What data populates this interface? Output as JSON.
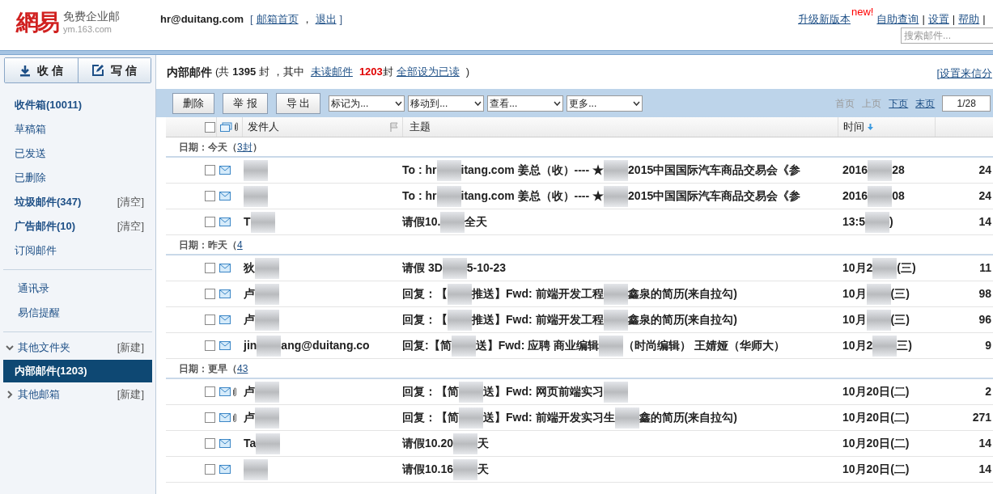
{
  "logo": {
    "mark": "網易",
    "product": "免费企业邮",
    "domain": "ym.163.com"
  },
  "account": {
    "email": "hr@duitang.com",
    "open": "[",
    "links": [
      "邮箱首页",
      "退出"
    ],
    "sep": "，",
    "close": "]"
  },
  "top_links": {
    "upgrade": "升级新版本",
    "new_badge": "new!",
    "links": [
      "自助查询",
      "设置",
      "帮助"
    ],
    "separator": "|"
  },
  "search": {
    "placeholder": "搜索邮件..."
  },
  "actions": [
    {
      "label": "收 信",
      "kind": "receive"
    },
    {
      "label": "写 信",
      "kind": "compose"
    }
  ],
  "sidebar": {
    "groups": [
      [
        {
          "label": "收件箱(10011)",
          "bold": true,
          "selected": false
        },
        {
          "label": "草稿箱",
          "bold": false,
          "selected": false
        },
        {
          "label": "已发送",
          "bold": false,
          "selected": false
        },
        {
          "label": "已删除",
          "bold": false,
          "selected": false
        },
        {
          "label": "垃圾邮件(347)",
          "bold": true,
          "selected": false,
          "action": "[清空]"
        },
        {
          "label": "广告邮件(10)",
          "bold": true,
          "selected": false,
          "action": "[清空]"
        },
        {
          "label": "订阅邮件",
          "bold": false,
          "selected": false
        }
      ],
      [
        {
          "label": "通讯录",
          "bold": false,
          "selected": false
        },
        {
          "label": "易信提醒",
          "bold": false,
          "selected": false
        }
      ]
    ],
    "folders": [
      {
        "label": "其他文件夹",
        "expanded": true,
        "action": "[新建]",
        "children": [
          {
            "label": "内部邮件(1203)",
            "bold": true,
            "selected": true
          }
        ]
      },
      {
        "label": "其他邮箱",
        "expanded": false,
        "action": "[新建]"
      }
    ]
  },
  "folder_title": {
    "name": "内部邮件",
    "pre": "(共",
    "total": "1395",
    "mid": "封 ，其中",
    "unread_link": "未读邮件",
    "unread": "1203",
    "unit": "封",
    "mark_all": "全部设为已读",
    "end": ")",
    "filter_link": "[设置来信分"
  },
  "toolbar": {
    "buttons": [
      "删除",
      "举 报",
      "导 出"
    ],
    "dropdowns": [
      "标记为...",
      "移动到...",
      "查看...",
      "更多..."
    ],
    "pager": [
      {
        "label": "首页",
        "disabled": true
      },
      {
        "label": "上页",
        "disabled": true
      },
      {
        "label": "下页",
        "disabled": false
      },
      {
        "label": "末页",
        "disabled": false
      }
    ],
    "page": "1/28"
  },
  "columns": {
    "select_all_checked": false,
    "sender": "发件人",
    "subject": "主题",
    "time": "时间"
  },
  "groups": [
    {
      "label": "日期：今天（",
      "count_link": "3封",
      "close": "）",
      "rows": [
        {
          "checked": false,
          "unread": true,
          "attachment": false,
          "sender": [
            {
              "kind": "redacted"
            }
          ],
          "subject": [
            {
              "text": "To : hr"
            },
            {
              "kind": "redacted"
            },
            {
              "text": "itang.com 姜总（收）---- ★"
            },
            {
              "kind": "redacted"
            },
            {
              "text": "2015中国国际汽车商品交易会《参"
            }
          ],
          "time": [
            {
              "text": "2016"
            },
            {
              "kind": "redacted"
            },
            {
              "text": "28"
            }
          ],
          "size": "24"
        },
        {
          "checked": false,
          "unread": true,
          "attachment": false,
          "sender": [
            {
              "kind": "redacted"
            }
          ],
          "subject": [
            {
              "text": "To : hr"
            },
            {
              "kind": "redacted"
            },
            {
              "text": "itang.com 姜总（收）---- ★"
            },
            {
              "kind": "redacted"
            },
            {
              "text": "2015中国国际汽车商品交易会《参"
            }
          ],
          "time": [
            {
              "text": "2016"
            },
            {
              "kind": "redacted"
            },
            {
              "text": "08"
            }
          ],
          "size": "24"
        },
        {
          "checked": false,
          "unread": true,
          "attachment": false,
          "sender": [
            {
              "text": "T"
            },
            {
              "kind": "redacted"
            }
          ],
          "subject": [
            {
              "text": "请假10."
            },
            {
              "kind": "redacted"
            },
            {
              "text": "全天"
            }
          ],
          "time": [
            {
              "text": "13:5"
            },
            {
              "kind": "redacted"
            },
            {
              "text": ")"
            }
          ],
          "size": "14"
        }
      ]
    },
    {
      "label": "日期：昨天（",
      "count_link": "4",
      "rows": [
        {
          "checked": false,
          "unread": true,
          "attachment": false,
          "sender": [
            {
              "text": "狄"
            },
            {
              "kind": "redacted"
            }
          ],
          "subject": [
            {
              "text": "请假 3D"
            },
            {
              "kind": "redacted"
            },
            {
              "text": "5-10-23"
            }
          ],
          "time": [
            {
              "text": "10月2"
            },
            {
              "kind": "redacted"
            },
            {
              "text": "(三)"
            }
          ],
          "size": "11"
        },
        {
          "checked": false,
          "unread": true,
          "attachment": false,
          "sender": [
            {
              "text": "卢"
            },
            {
              "kind": "redacted"
            }
          ],
          "subject": [
            {
              "text": "回复：【"
            },
            {
              "kind": "redacted"
            },
            {
              "text": "推送】Fwd: 前端开发工程"
            },
            {
              "kind": "redacted"
            },
            {
              "text": "鑫泉的简历(来自拉勾)"
            }
          ],
          "time": [
            {
              "text": "10月"
            },
            {
              "kind": "redacted"
            },
            {
              "text": "(三)"
            }
          ],
          "size": "98"
        },
        {
          "checked": false,
          "unread": true,
          "attachment": false,
          "sender": [
            {
              "text": "卢"
            },
            {
              "kind": "redacted"
            }
          ],
          "subject": [
            {
              "text": "回复：【"
            },
            {
              "kind": "redacted"
            },
            {
              "text": "推送】Fwd: 前端开发工程"
            },
            {
              "kind": "redacted"
            },
            {
              "text": "鑫泉的简历(来自拉勾)"
            }
          ],
          "time": [
            {
              "text": "10月"
            },
            {
              "kind": "redacted"
            },
            {
              "text": "(三)"
            }
          ],
          "size": "96"
        },
        {
          "checked": false,
          "unread": true,
          "attachment": false,
          "sender": [
            {
              "text": "jin"
            },
            {
              "kind": "redacted"
            },
            {
              "text": "ang@duitang.co"
            }
          ],
          "subject": [
            {
              "text": "回复:【简"
            },
            {
              "kind": "redacted"
            },
            {
              "text": "送】Fwd: 应聘 商业编辑"
            },
            {
              "kind": "redacted"
            },
            {
              "text": "（时尚编辑） 王婧娅（华师大）"
            }
          ],
          "time": [
            {
              "text": "10月2"
            },
            {
              "kind": "redacted"
            },
            {
              "text": "三)"
            }
          ],
          "size": "9"
        }
      ]
    },
    {
      "label": "日期：更早（",
      "count_link": "43",
      "rows": [
        {
          "checked": false,
          "unread": true,
          "attachment": true,
          "sender": [
            {
              "text": "卢"
            },
            {
              "kind": "redacted"
            }
          ],
          "subject": [
            {
              "text": "回复：【简"
            },
            {
              "kind": "redacted"
            },
            {
              "text": "送】Fwd: 网页前端实习"
            },
            {
              "kind": "redacted"
            }
          ],
          "time": [
            {
              "text": "10月20日(二)"
            }
          ],
          "size": "2"
        },
        {
          "checked": false,
          "unread": true,
          "attachment": true,
          "sender": [
            {
              "text": "卢"
            },
            {
              "kind": "redacted"
            }
          ],
          "subject": [
            {
              "text": "回复：【简"
            },
            {
              "kind": "redacted"
            },
            {
              "text": "送】Fwd: 前端开发实习生"
            },
            {
              "kind": "redacted"
            },
            {
              "text": "鑫的简历(来自拉勾)"
            }
          ],
          "time": [
            {
              "text": "10月20日(二)"
            }
          ],
          "size": "271"
        },
        {
          "checked": false,
          "unread": true,
          "attachment": false,
          "sender": [
            {
              "text": "Ta"
            },
            {
              "kind": "redacted"
            }
          ],
          "subject": [
            {
              "text": "请假10.20"
            },
            {
              "kind": "redacted"
            },
            {
              "text": "天"
            }
          ],
          "time": [
            {
              "text": "10月20日(二)"
            }
          ],
          "size": "14"
        },
        {
          "checked": false,
          "unread": true,
          "attachment": false,
          "sender": [
            {
              "kind": "redacted"
            }
          ],
          "subject": [
            {
              "text": "请假10.16"
            },
            {
              "kind": "redacted"
            },
            {
              "text": "天"
            }
          ],
          "time": [
            {
              "text": "10月20日(二)"
            }
          ],
          "size": "14"
        }
      ]
    }
  ]
}
